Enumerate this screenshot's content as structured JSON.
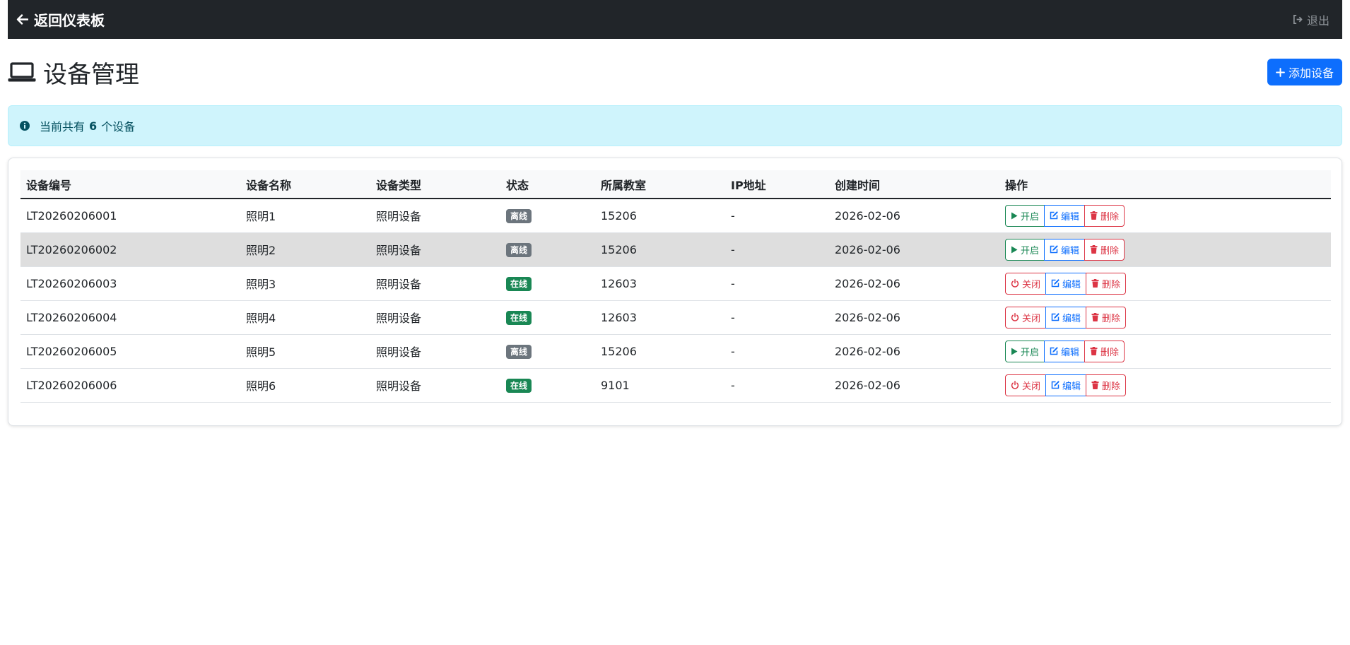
{
  "navbar": {
    "back_label": "返回仪表板",
    "logout_label": "退出"
  },
  "page": {
    "title": "设备管理",
    "add_button_label": "添加设备"
  },
  "alert": {
    "prefix": "当前共有",
    "count": "6",
    "suffix": "个设备"
  },
  "table": {
    "headers": [
      "设备编号",
      "设备名称",
      "设备类型",
      "状态",
      "所属教室",
      "IP地址",
      "创建时间",
      "操作"
    ],
    "rows": [
      {
        "id": "LT20260206001",
        "name": "照明1",
        "type": "照明设备",
        "status": "离线",
        "classroom": "15206",
        "ip": "-",
        "created": "2026-02-06",
        "toggle": "开启"
      },
      {
        "id": "LT20260206002",
        "name": "照明2",
        "type": "照明设备",
        "status": "离线",
        "classroom": "15206",
        "ip": "-",
        "created": "2026-02-06",
        "toggle": "开启"
      },
      {
        "id": "LT20260206003",
        "name": "照明3",
        "type": "照明设备",
        "status": "在线",
        "classroom": "12603",
        "ip": "-",
        "created": "2026-02-06",
        "toggle": "关闭"
      },
      {
        "id": "LT20260206004",
        "name": "照明4",
        "type": "照明设备",
        "status": "在线",
        "classroom": "12603",
        "ip": "-",
        "created": "2026-02-06",
        "toggle": "关闭"
      },
      {
        "id": "LT20260206005",
        "name": "照明5",
        "type": "照明设备",
        "status": "离线",
        "classroom": "15206",
        "ip": "-",
        "created": "2026-02-06",
        "toggle": "开启"
      },
      {
        "id": "LT20260206006",
        "name": "照明6",
        "type": "照明设备",
        "status": "在线",
        "classroom": "9101",
        "ip": "-",
        "created": "2026-02-06",
        "toggle": "关闭"
      }
    ],
    "action_labels": {
      "edit": "编辑",
      "delete": "删除"
    },
    "highlighted_row": 1
  },
  "colors": {
    "navbar": "#212529",
    "primary": "#0d6efd",
    "success": "#198754",
    "danger": "#dc3545",
    "secondary": "#6c757d",
    "info_bg": "#cff4fc"
  },
  "icons": {
    "back": "arrow-left-icon",
    "logout": "sign-out-icon",
    "title": "laptop-icon",
    "add": "plus-icon",
    "info": "info-circle-icon",
    "start": "play-icon",
    "stop": "power-icon",
    "edit": "edit-icon",
    "delete": "trash-icon"
  }
}
